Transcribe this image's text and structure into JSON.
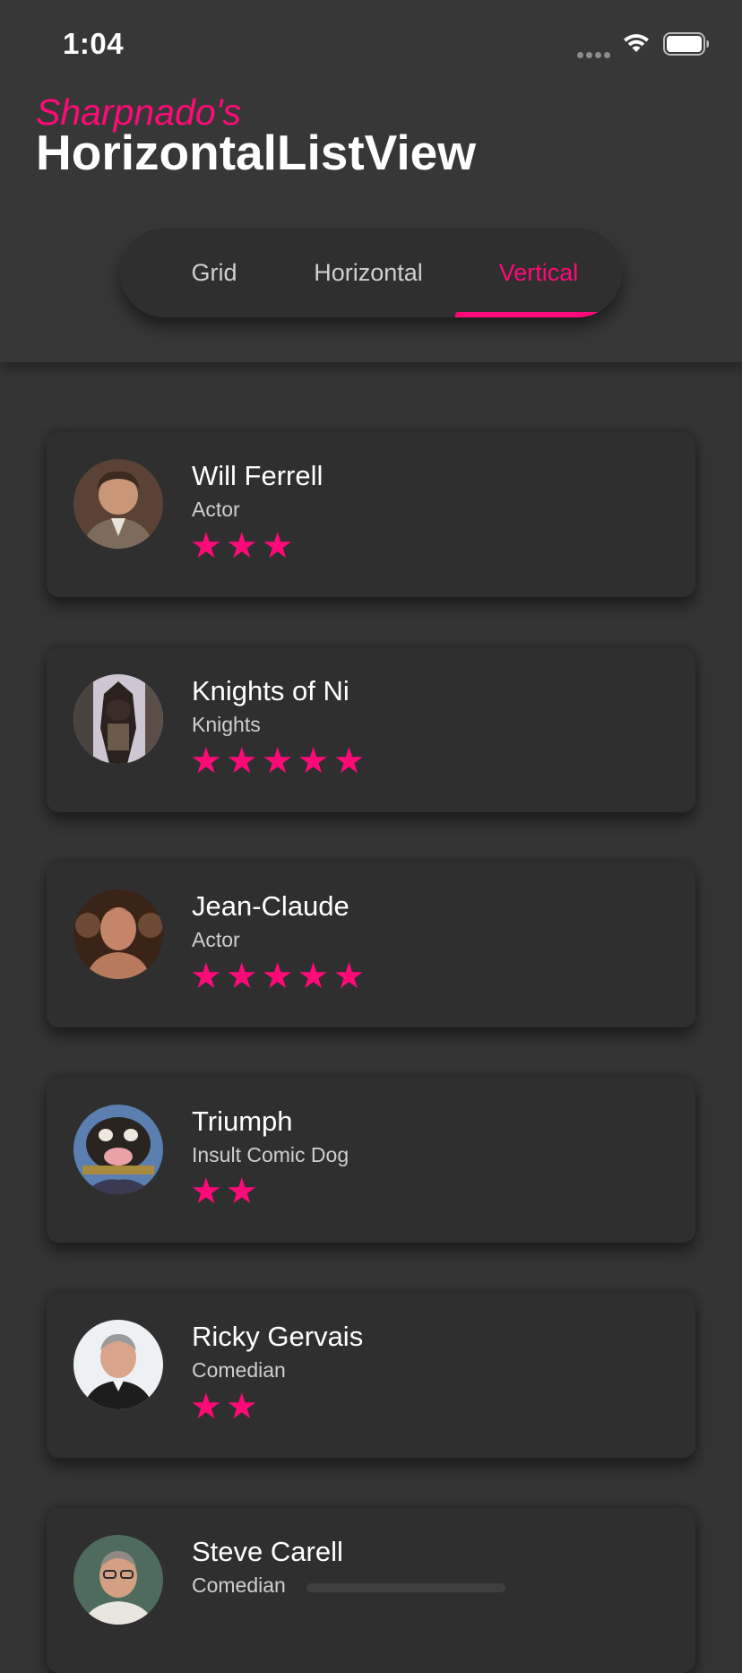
{
  "status_bar": {
    "time": "1:04",
    "icons": [
      "cellular-signal-icon",
      "wifi-icon",
      "battery-icon"
    ]
  },
  "header": {
    "subtitle": "Sharpnado's",
    "title": "HorizontalListView"
  },
  "tabs": [
    {
      "label": "Grid",
      "active": false
    },
    {
      "label": "Horizontal",
      "active": false
    },
    {
      "label": "Vertical",
      "active": true
    }
  ],
  "colors": {
    "accent": "#ff0a78",
    "background": "#343434",
    "card": "#2f2f2f",
    "header": "#373737"
  },
  "people": [
    {
      "name": "Will Ferrell",
      "role": "Actor",
      "rating": 3,
      "max_rating": 5
    },
    {
      "name": "Knights of Ni",
      "role": "Knights",
      "rating": 5,
      "max_rating": 5
    },
    {
      "name": "Jean-Claude",
      "role": "Actor",
      "rating": 5,
      "max_rating": 5
    },
    {
      "name": "Triumph",
      "role": "Insult Comic Dog",
      "rating": 2,
      "max_rating": 5
    },
    {
      "name": "Ricky Gervais",
      "role": "Comedian",
      "rating": 2,
      "max_rating": 5
    },
    {
      "name": "Steve Carell",
      "role": "Comedian",
      "rating": null,
      "max_rating": 5
    }
  ]
}
